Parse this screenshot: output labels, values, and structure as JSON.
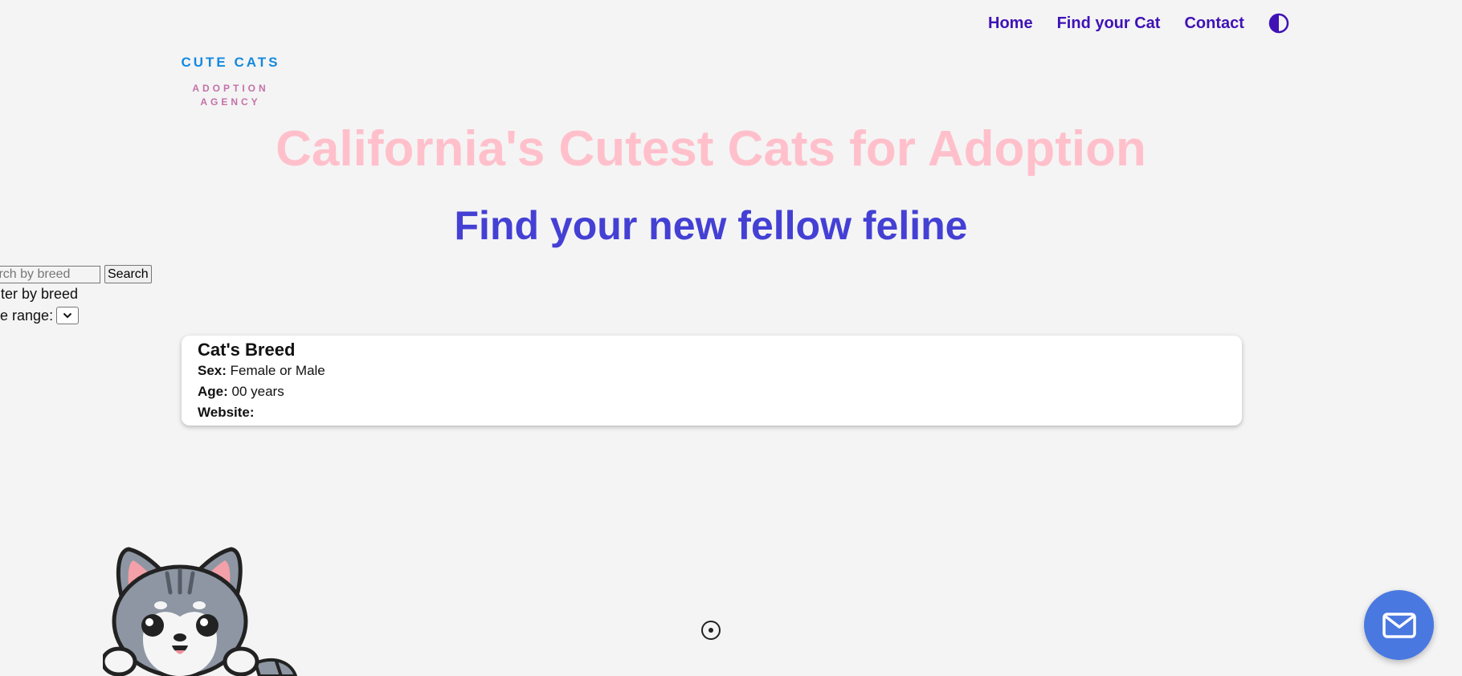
{
  "nav": {
    "items": [
      {
        "label": "Home"
      },
      {
        "label": "Find your Cat"
      },
      {
        "label": "Contact"
      }
    ],
    "theme_toggle_icon": "contrast-icon",
    "link_color": "#3f12b6"
  },
  "logo": {
    "title": "CUTE CATS",
    "subtitle": "ADOPTION AGENCY",
    "title_color": "#1389e0",
    "subtitle_color": "#c472a7"
  },
  "hero": {
    "title": "California's Cutest Cats for Adoption",
    "subtitle": "Find your new fellow feline",
    "title_color": "#ffc0cb",
    "subtitle_color": "#4440d4"
  },
  "search": {
    "placeholder": "Search by breed",
    "button_label": "Search",
    "filter_label": "Filter by breed",
    "range_label": "Age range:",
    "range_value": ""
  },
  "card": {
    "title": "Cat's Breed",
    "sex_label": "Sex:",
    "sex_value": "Female or Male",
    "age_label": "Age:",
    "age_value": "00 years",
    "website_label": "Website:",
    "website_value": ""
  },
  "contact_button": {
    "icon": "mail-icon",
    "color": "#4a78e1"
  },
  "mascot": {
    "icon": "cat-mascot-illustration"
  }
}
